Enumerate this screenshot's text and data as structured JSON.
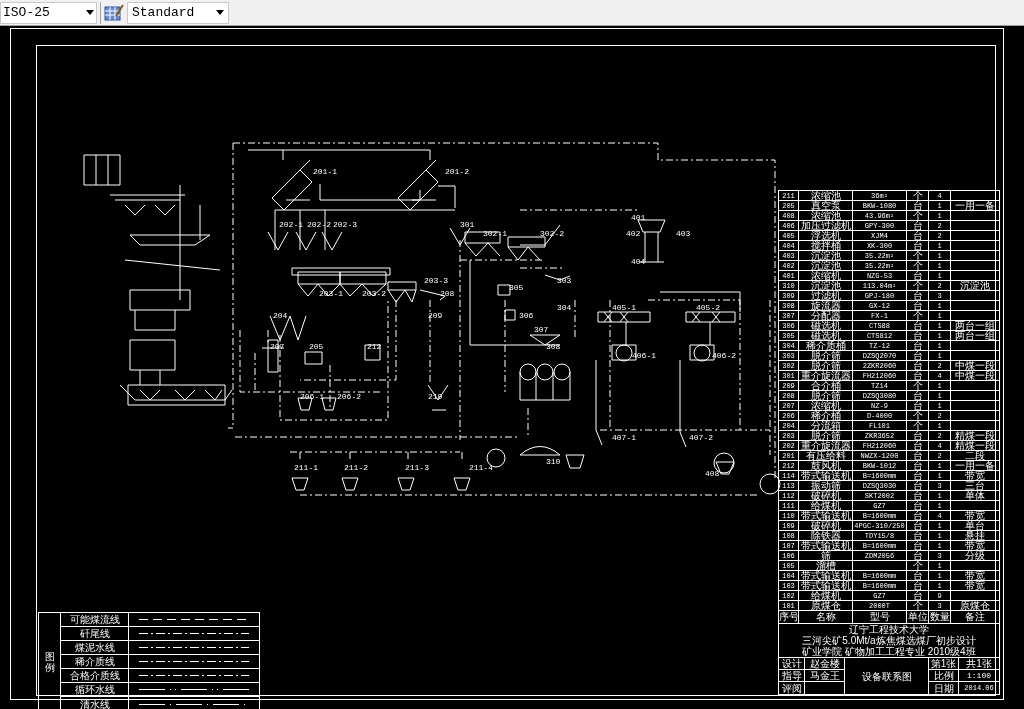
{
  "toolbar": {
    "dim_style": "ISO-25",
    "table_style": "Standard"
  },
  "labels": [
    "201-1",
    "201-2",
    "401",
    "202-1",
    "202-2",
    "202-3",
    "301",
    "302-1",
    "302-2",
    "402",
    "403",
    "404",
    "203-3",
    "303",
    "305",
    "203-1",
    "203-2",
    "208",
    "304",
    "405-1",
    "405-2",
    "204",
    "209",
    "306",
    "307",
    "207",
    "205",
    "212",
    "308",
    "406-1",
    "406-2",
    "206-1",
    "206-2",
    "210",
    "407-1",
    "407-2",
    "310",
    "211-1",
    "211-2",
    "211-3",
    "211-4",
    "408"
  ],
  "equipment_table": {
    "rows": [
      [
        "211",
        "浓缩池",
        "36m²",
        "个",
        "4",
        ""
      ],
      [
        "205",
        "真空泵",
        "BKW-1080",
        "台",
        "1",
        "一用一备"
      ],
      [
        "408",
        "浓缩池",
        "43.96m²",
        "个",
        "1",
        ""
      ],
      [
        "406",
        "加压过滤机",
        "GPY-300",
        "台",
        "2",
        ""
      ],
      [
        "405",
        "浮选机",
        "XJM4",
        "台",
        "2",
        ""
      ],
      [
        "404",
        "搅拌桶",
        "XK-300",
        "台",
        "1",
        ""
      ],
      [
        "403",
        "沉淀池",
        "35.22m²",
        "个",
        "1",
        ""
      ],
      [
        "402",
        "沉淀池",
        "35.22m²",
        "个",
        "1",
        ""
      ],
      [
        "401",
        "浓缩机",
        "NZG-53",
        "台",
        "1",
        ""
      ],
      [
        "310",
        "沉淀池",
        "113.04m²",
        "个",
        "2",
        "沉淀池"
      ],
      [
        "309",
        "过滤机",
        "GPJ-180",
        "台",
        "3",
        ""
      ],
      [
        "308",
        "旋流器",
        "GX-12",
        "台",
        "1",
        ""
      ],
      [
        "307",
        "分配器",
        "FX-1",
        "个",
        "1",
        ""
      ],
      [
        "306",
        "磁选机",
        "CTS88",
        "台",
        "1",
        "两台一组"
      ],
      [
        "305",
        "磁选机",
        "CTS812",
        "台",
        "1",
        "两台一组"
      ],
      [
        "304",
        "稀介质桶",
        "TZ-12",
        "台",
        "1",
        ""
      ],
      [
        "303",
        "脱介筛",
        "DZSQ2070",
        "台",
        "1",
        ""
      ],
      [
        "302",
        "脱介筛",
        "2ZKR2060",
        "台",
        "2",
        "中煤一段"
      ],
      [
        "301",
        "重介旋流器",
        "FH212060",
        "台",
        "4",
        "中煤一段"
      ],
      [
        "209",
        "合介桶",
        "TZ14",
        "个",
        "1",
        ""
      ],
      [
        "208",
        "脱介筛",
        "DZSQ3080",
        "台",
        "1",
        ""
      ],
      [
        "207",
        "浓缩机",
        "NZ-9",
        "台",
        "1",
        ""
      ],
      [
        "206",
        "稀介桶",
        "D-4000",
        "个",
        "2",
        ""
      ],
      [
        "204",
        "分流箱",
        "FL101",
        "个",
        "1",
        ""
      ],
      [
        "203",
        "脱介筛",
        "ZKR3652",
        "台",
        "2",
        "精煤一段"
      ],
      [
        "202",
        "重介旋流器",
        "FH212060",
        "台",
        "4",
        "精煤一段"
      ],
      [
        "201",
        "有压给料",
        "NWZX-1200",
        "台",
        "2",
        "二段"
      ],
      [
        "212",
        "鼓风机",
        "BKW-1012",
        "台",
        "1",
        "一用一备"
      ],
      [
        "114",
        "带式输送机",
        "B=1600mm",
        "台",
        "1",
        "带宽"
      ],
      [
        "113",
        "振动筛",
        "DZSQ3030",
        "台",
        "3",
        "三台"
      ],
      [
        "112",
        "破碎机",
        "SKT2002",
        "台",
        "1",
        "单体"
      ],
      [
        "111",
        "给煤机",
        "GZ7",
        "台",
        "1",
        ""
      ],
      [
        "110",
        "带式输送机",
        "B=1600mm",
        "台",
        "4",
        "带宽"
      ],
      [
        "109",
        "破碎机",
        "4PGC-310/250",
        "台",
        "1",
        "单台"
      ],
      [
        "108",
        "除铁器",
        "TDY15/8",
        "台",
        "1",
        "悬挂"
      ],
      [
        "107",
        "带式输送机",
        "B=1600mm",
        "台",
        "1",
        "带宽"
      ],
      [
        "106",
        "筛",
        "ZDM2056",
        "台",
        "3",
        "分级"
      ],
      [
        "105",
        "溜槽",
        "",
        "个",
        "1",
        ""
      ],
      [
        "104",
        "带式输送机",
        "B=1600mm",
        "台",
        "1",
        "带宽"
      ],
      [
        "103",
        "带式输送机",
        "B=1600mm",
        "台",
        "1",
        "带宽"
      ],
      [
        "102",
        "给煤机",
        "GZ7",
        "台",
        "9",
        ""
      ],
      [
        "101",
        "原煤仓",
        "2000T",
        "个",
        "3",
        "原煤仓"
      ]
    ],
    "header_row": [
      "序号",
      "名称",
      "型号",
      "单位",
      "数量",
      "备注"
    ]
  },
  "title_block": {
    "lines": [
      "辽宁工程技术大学",
      "三河尖矿5.0Mt/a炼焦煤选煤厂初步设计",
      "矿业学院 矿物加工工程专业 2010级4班"
    ],
    "designer_label": "设计",
    "designer": "赵金楼",
    "advisor_label": "指导",
    "advisor": "马金王",
    "reviewer_label": "评阅",
    "drawing_title": "设备联系图",
    "sheet": "第1张",
    "sheets": "共1张",
    "scale_label": "比例",
    "scale": "1:100",
    "date_label": "日期",
    "date": "2014.06"
  },
  "legend": {
    "title": "图例",
    "items": [
      {
        "label": "可能煤流线",
        "kind": "dash"
      },
      {
        "label": "矸尾线",
        "kind": "dashdot"
      },
      {
        "label": "煤泥水线",
        "kind": "dashdot"
      },
      {
        "label": "稀介质线",
        "kind": "dashdot"
      },
      {
        "label": "合格介质线",
        "kind": "dashdot"
      },
      {
        "label": "循环水线",
        "kind": "longdotdot"
      },
      {
        "label": "清水线",
        "kind": "longdot"
      }
    ]
  }
}
